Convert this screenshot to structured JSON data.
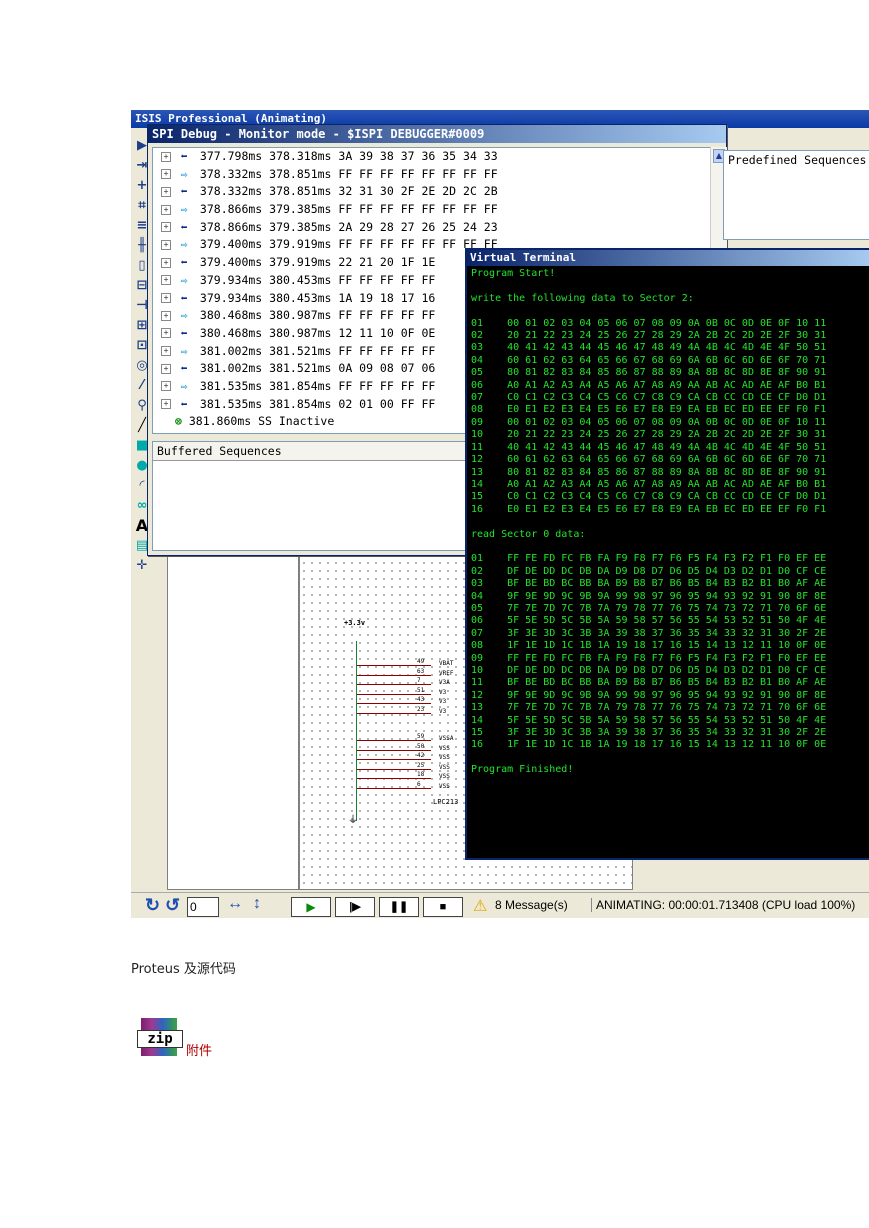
{
  "app": {
    "title": "ISIS Professional (Animating)",
    "title_prefix": "ISIS"
  },
  "spi": {
    "title": "SPI Debug - Monitor mode - $ISPI DEBUGGER#0009",
    "rows": [
      {
        "dir": "in",
        "t1": "377.798ms",
        "t2": "378.318ms",
        "data": "3A 39 38 37 36 35 34 33"
      },
      {
        "dir": "out",
        "t1": "378.332ms",
        "t2": "378.851ms",
        "data": "FF FF FF FF FF FF FF FF"
      },
      {
        "dir": "in",
        "t1": "378.332ms",
        "t2": "378.851ms",
        "data": "32 31 30 2F 2E 2D 2C 2B"
      },
      {
        "dir": "out",
        "t1": "378.866ms",
        "t2": "379.385ms",
        "data": "FF FF FF FF FF FF FF FF"
      },
      {
        "dir": "in",
        "t1": "378.866ms",
        "t2": "379.385ms",
        "data": "2A 29 28 27 26 25 24 23"
      },
      {
        "dir": "out",
        "t1": "379.400ms",
        "t2": "379.919ms",
        "data": "FF FF FF FF FF FF FF FF"
      },
      {
        "dir": "in",
        "t1": "379.400ms",
        "t2": "379.919ms",
        "data": "22 21 20 1F 1E"
      },
      {
        "dir": "out",
        "t1": "379.934ms",
        "t2": "380.453ms",
        "data": "FF FF FF FF FF"
      },
      {
        "dir": "in",
        "t1": "379.934ms",
        "t2": "380.453ms",
        "data": "1A 19 18 17 16"
      },
      {
        "dir": "out",
        "t1": "380.468ms",
        "t2": "380.987ms",
        "data": "FF FF FF FF FF"
      },
      {
        "dir": "in",
        "t1": "380.468ms",
        "t2": "380.987ms",
        "data": "12 11 10 0F 0E"
      },
      {
        "dir": "out",
        "t1": "381.002ms",
        "t2": "381.521ms",
        "data": "FF FF FF FF FF"
      },
      {
        "dir": "in",
        "t1": "381.002ms",
        "t2": "381.521ms",
        "data": "0A 09 08 07 06"
      },
      {
        "dir": "out",
        "t1": "381.535ms",
        "t2": "381.854ms",
        "data": "FF FF FF FF FF"
      },
      {
        "dir": "in",
        "t1": "381.535ms",
        "t2": "381.854ms",
        "data": "02 01 00 FF FF"
      }
    ],
    "final": {
      "t1": "381.860ms",
      "label": "SS Inactive"
    },
    "predefined_label": "Predefined Sequences",
    "buffered_label": "Buffered Sequences"
  },
  "terminal": {
    "title": "Virtual Terminal",
    "lines": [
      "Program Start!",
      "",
      "write the following data to Sector 2:",
      "",
      "01    00 01 02 03 04 05 06 07 08 09 0A 0B 0C 0D 0E 0F 10 11",
      "02    20 21 22 23 24 25 26 27 28 29 2A 2B 2C 2D 2E 2F 30 31",
      "03    40 41 42 43 44 45 46 47 48 49 4A 4B 4C 4D 4E 4F 50 51",
      "04    60 61 62 63 64 65 66 67 68 69 6A 6B 6C 6D 6E 6F 70 71",
      "05    80 81 82 83 84 85 86 87 88 89 8A 8B 8C 8D 8E 8F 90 91",
      "06    A0 A1 A2 A3 A4 A5 A6 A7 A8 A9 AA AB AC AD AE AF B0 B1",
      "07    C0 C1 C2 C3 C4 C5 C6 C7 C8 C9 CA CB CC CD CE CF D0 D1",
      "08    E0 E1 E2 E3 E4 E5 E6 E7 E8 E9 EA EB EC ED EE EF F0 F1",
      "09    00 01 02 03 04 05 06 07 08 09 0A 0B 0C 0D 0E 0F 10 11",
      "10    20 21 22 23 24 25 26 27 28 29 2A 2B 2C 2D 2E 2F 30 31",
      "11    40 41 42 43 44 45 46 47 48 49 4A 4B 4C 4D 4E 4F 50 51",
      "12    60 61 62 63 64 65 66 67 68 69 6A 6B 6C 6D 6E 6F 70 71",
      "13    80 81 82 83 84 85 86 87 88 89 8A 8B 8C 8D 8E 8F 90 91",
      "14    A0 A1 A2 A3 A4 A5 A6 A7 A8 A9 AA AB AC AD AE AF B0 B1",
      "15    C0 C1 C2 C3 C4 C5 C6 C7 C8 C9 CA CB CC CD CE CF D0 D1",
      "16    E0 E1 E2 E3 E4 E5 E6 E7 E8 E9 EA EB EC ED EE EF F0 F1",
      "",
      "read Sector 0 data:",
      "",
      "01    FF FE FD FC FB FA F9 F8 F7 F6 F5 F4 F3 F2 F1 F0 EF EE",
      "02    DF DE DD DC DB DA D9 D8 D7 D6 D5 D4 D3 D2 D1 D0 CF CE",
      "03    BF BE BD BC BB BA B9 B8 B7 B6 B5 B4 B3 B2 B1 B0 AF AE",
      "04    9F 9E 9D 9C 9B 9A 99 98 97 96 95 94 93 92 91 90 8F 8E",
      "05    7F 7E 7D 7C 7B 7A 79 78 77 76 75 74 73 72 71 70 6F 6E",
      "06    5F 5E 5D 5C 5B 5A 59 58 57 56 55 54 53 52 51 50 4F 4E",
      "07    3F 3E 3D 3C 3B 3A 39 38 37 36 35 34 33 32 31 30 2F 2E",
      "08    1F 1E 1D 1C 1B 1A 19 18 17 16 15 14 13 12 11 10 0F 0E",
      "09    FF FE FD FC FB FA F9 F8 F7 F6 F5 F4 F3 F2 F1 F0 EF EE",
      "10    DF DE DD DC DB DA D9 D8 D7 D6 D5 D4 D3 D2 D1 D0 CF CE",
      "11    BF BE BD BC BB BA B9 B8 B7 B6 B5 B4 B3 B2 B1 B0 AF AE",
      "12    9F 9E 9D 9C 9B 9A 99 98 97 96 95 94 93 92 91 90 8F 8E",
      "13    7F 7E 7D 7C 7B 7A 79 78 77 76 75 74 73 72 71 70 6F 6E",
      "14    5F 5E 5D 5C 5B 5A 59 58 57 56 55 54 53 52 51 50 4F 4E",
      "15    3F 3E 3D 3C 3B 3A 39 38 37 36 35 34 33 32 31 30 2F 2E",
      "16    1F 1E 1D 1C 1B 1A 19 18 17 16 15 14 13 12 11 10 0F 0E",
      "",
      "Program Finished!"
    ]
  },
  "schematic": {
    "supply_label": "+3.3v",
    "pins": [
      {
        "num": "49",
        "name": "VBAT"
      },
      {
        "num": "63",
        "name": "VREF"
      },
      {
        "num": "7",
        "name": "V3A"
      },
      {
        "num": "51",
        "name": "V3"
      },
      {
        "num": "43",
        "name": "V3"
      },
      {
        "num": "23",
        "name": "V3"
      },
      {
        "num": "59",
        "name": "VSSA"
      },
      {
        "num": "50",
        "name": "VSS"
      },
      {
        "num": "42",
        "name": "VSS"
      },
      {
        "num": "25",
        "name": "VSS"
      },
      {
        "num": "18",
        "name": "VSS"
      },
      {
        "num": "6",
        "name": "VSS"
      }
    ],
    "chip_label": "LPC213"
  },
  "statusbar": {
    "rotation_value": "0",
    "messages": "8 Message(s)",
    "status": "ANIMATING: 00:00:01.713408 (CPU load 100%)"
  },
  "doc": {
    "caption": "Proteus 及源代码",
    "attachment_label": "附件",
    "zip_text": "zip"
  },
  "colors": {
    "terminal_text": "#22e32b",
    "terminal_bg": "#000000",
    "title_blue": "#0a246a"
  }
}
